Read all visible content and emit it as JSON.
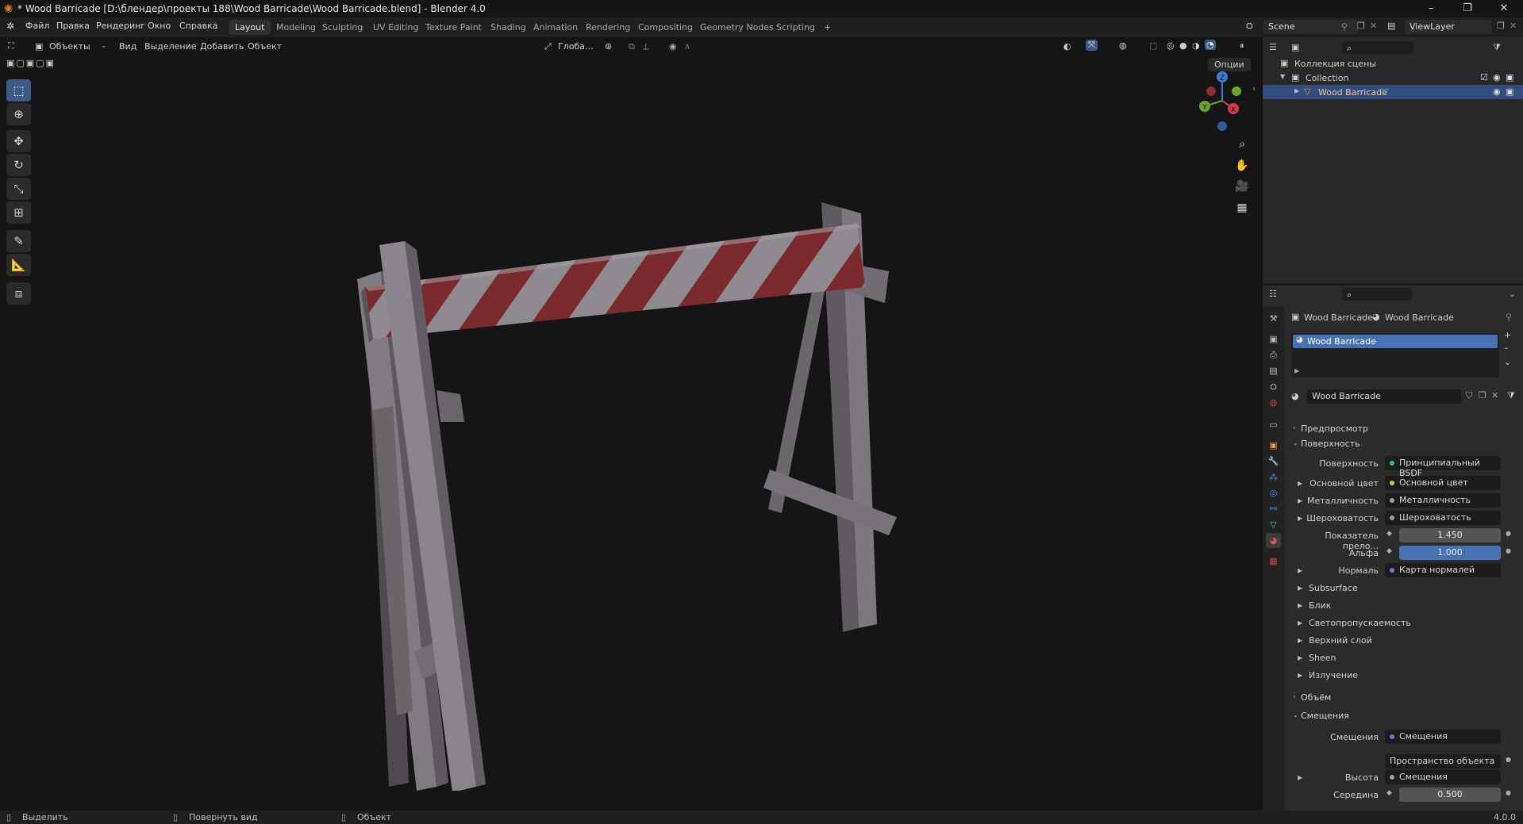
{
  "window": {
    "title": "* Wood Barricade [D:\\блендер\\проекты 188\\Wood Barricade\\Wood Barricade.blend] - Blender 4.0",
    "minimize": "–",
    "maximize": "❐",
    "close": "✕"
  },
  "menu": {
    "items": [
      "Файл",
      "Правка",
      "Рендеринг",
      "Окно",
      "Справка"
    ]
  },
  "workspaces": {
    "tabs": [
      "Layout",
      "Modeling",
      "Sculpting",
      "UV Editing",
      "Texture Paint",
      "Shading",
      "Animation",
      "Rendering",
      "Compositing",
      "Geometry Nodes",
      "Scripting"
    ],
    "active": "Layout",
    "add": "+"
  },
  "scene": {
    "scene_name": "Scene",
    "view_layer": "ViewLayer"
  },
  "viewport_header": {
    "mode": "Объекты",
    "view": "Вид",
    "select": "Выделение",
    "add": "Добавить",
    "object": "Объект",
    "transform_orientation": "Глоба...",
    "options": "Опции"
  },
  "gizmo": {
    "x": "X",
    "y": "Y",
    "z": "Z"
  },
  "outliner": {
    "scene_collection": "Коллекция сцены",
    "collection": "Collection",
    "object": "Wood Barricade"
  },
  "properties": {
    "breadcrumb_object": "Wood Barricade",
    "breadcrumb_material": "Wood Barricade",
    "material_slot": "Wood Barricade",
    "material_name": "Wood Barricade",
    "sections": {
      "preview": "Предпросмотр",
      "surface": "Поверхность",
      "volume": "Объём",
      "displacement": "Смещения"
    },
    "surface_rows": [
      {
        "label": "Поверхность",
        "value": "Принципиальный BSDF",
        "dot": "green",
        "expand": false
      },
      {
        "label": "Основной цвет",
        "value": "Основной цвет",
        "dot": "yellow",
        "expand": true
      },
      {
        "label": "Металличность",
        "value": "Металличность",
        "dot": "grey",
        "expand": true
      },
      {
        "label": "Шероховатость",
        "value": "Шероховатость",
        "dot": "grey",
        "expand": true
      }
    ],
    "ior_label": "Показатель прело...",
    "ior_value": "1.450",
    "alpha_label": "Альфа",
    "alpha_value": "1.000",
    "normal_label": "Нормаль",
    "normal_value": "Карта нормалей",
    "subsections": [
      "Subsurface",
      "Блик",
      "Светопропускаемость",
      "Верхний слой",
      "Sheen",
      "Излучение"
    ],
    "disp_label": "Смещения",
    "disp_value": "Смещения",
    "space_value": "Пространство объекта",
    "height_label": "Высота",
    "height_value": "Смещения",
    "midlevel_label": "Середина",
    "midlevel_value": "0.500"
  },
  "statusbar": {
    "select": "Выделить",
    "rotate": "Повернуть вид",
    "object": "Объект",
    "version": "4.0.0"
  }
}
